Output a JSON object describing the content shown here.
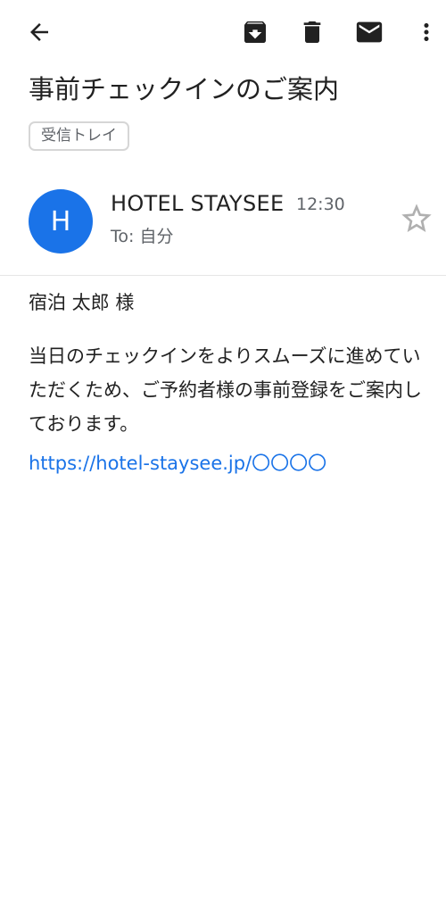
{
  "toolbar": {
    "back_icon": "arrow-left-icon",
    "archive_icon": "archive-icon",
    "delete_icon": "trash-icon",
    "mark_unread_icon": "mail-icon",
    "more_icon": "more-vertical-icon"
  },
  "message": {
    "subject": "事前チェックインのご案内",
    "label": "受信トレイ",
    "avatar_initial": "H",
    "sender": "HOTEL STAYSEE",
    "time": "12:30",
    "recipient": "To: 自分",
    "star_icon": "star-outline-icon"
  },
  "content": {
    "greeting": "宿泊 太郎 様",
    "paragraph": "当日のチェックインをよりスムーズに進めていただくため、ご予約者様の事前登録をご案内しております。",
    "link": "https://hotel-staysee.jp/〇〇〇〇"
  },
  "colors": {
    "accent": "#1a73e8",
    "icon": "#212121",
    "secondary_text": "#5f6368"
  }
}
